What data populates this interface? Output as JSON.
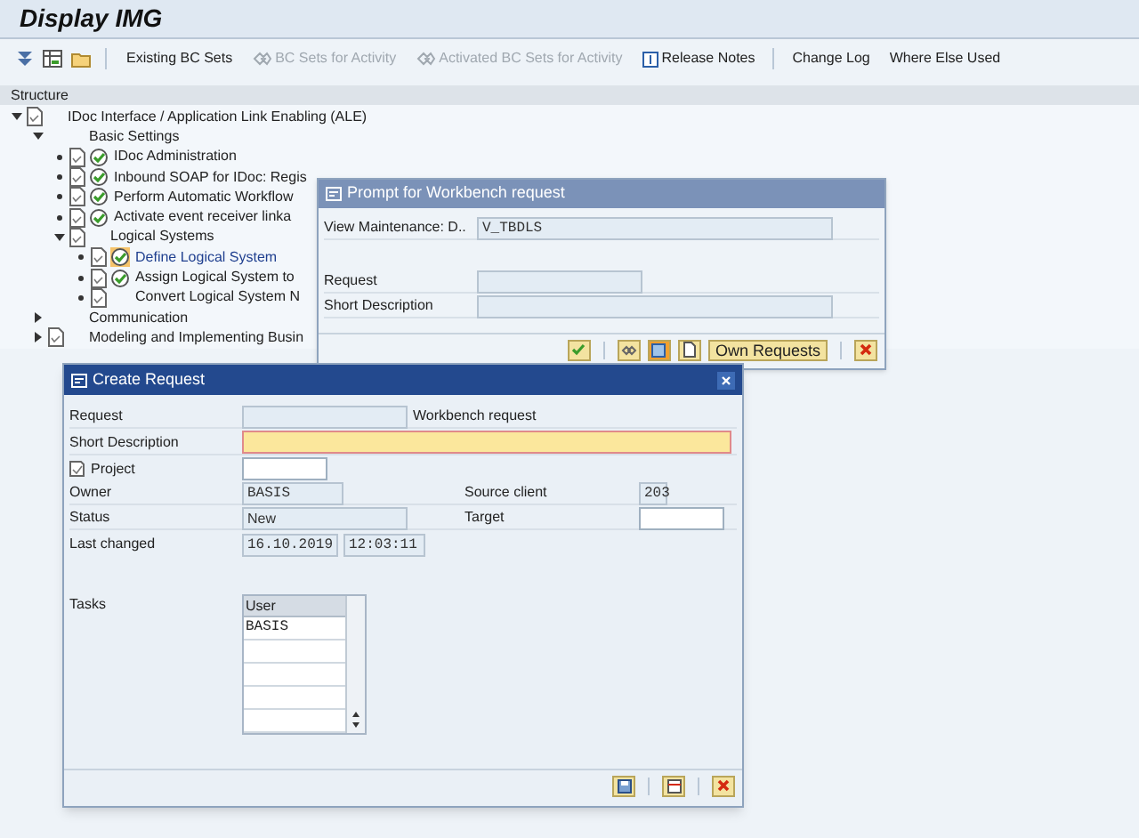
{
  "window": {
    "title": "Display IMG"
  },
  "toolbar": [
    {
      "label": "Existing BC Sets",
      "disabled": false
    },
    {
      "label": "BC Sets for Activity",
      "disabled": true
    },
    {
      "label": "Activated BC Sets for Activity",
      "disabled": true
    },
    {
      "label": "Release Notes",
      "disabled": false
    },
    {
      "label": "Change Log",
      "disabled": false
    },
    {
      "label": "Where Else Used",
      "disabled": false
    }
  ],
  "structure": {
    "header": "Structure",
    "tree": [
      {
        "label": "IDoc Interface / Application Link Enabling (ALE)",
        "documented": true,
        "expanded": true,
        "children": [
          {
            "label": "Basic Settings",
            "documented": false,
            "expanded": true,
            "children": [
              {
                "label": "IDoc Administration",
                "documented": true,
                "executable": true,
                "selected": false
              },
              {
                "label": "Inbound SOAP for IDoc: Regis",
                "documented": true,
                "executable": true,
                "selected": false
              },
              {
                "label": "Perform Automatic Workflow",
                "documented": true,
                "executable": true,
                "selected": false
              },
              {
                "label": "Activate event receiver linka",
                "documented": true,
                "executable": true,
                "selected": false
              },
              {
                "label": "Logical Systems",
                "documented": true,
                "expanded": true,
                "children": [
                  {
                    "label": "Define Logical System",
                    "documented": true,
                    "executable": true,
                    "selected": true
                  },
                  {
                    "label": "Assign Logical System to",
                    "documented": true,
                    "executable": true,
                    "selected": false
                  },
                  {
                    "label": "Convert Logical System N",
                    "documented": true,
                    "executable": false,
                    "selected": false
                  }
                ]
              }
            ]
          },
          {
            "label": "Communication",
            "documented": false,
            "expanded": false
          },
          {
            "label": "Modeling and Implementing Busin",
            "documented": true,
            "expanded": false
          }
        ]
      }
    ]
  },
  "prompt_dialog": {
    "title": "Prompt for Workbench request",
    "fields": [
      {
        "label": "View Maintenance: D..",
        "value": "V_TBDLS"
      },
      {
        "label": "Request"
      },
      {
        "label": "Short Description"
      }
    ],
    "own_requests_button": "Own Requests"
  },
  "create_dialog": {
    "title": "Create Request",
    "request": {
      "label": "Request",
      "type_text": "Workbench request"
    },
    "short_description": {
      "label": "Short Description",
      "required": true
    },
    "project": {
      "label": "Project"
    },
    "owner": {
      "label": "Owner",
      "value": "BASIS"
    },
    "source_client": {
      "label": "Source client",
      "value": "203"
    },
    "status": {
      "label": "Status",
      "value": "New"
    },
    "target": {
      "label": "Target"
    },
    "last_changed": {
      "label": "Last changed",
      "date": "16.10.2019",
      "time": "12:03:11"
    },
    "tasks": {
      "label": "Tasks",
      "column": "User",
      "rows": [
        "BASIS"
      ]
    }
  }
}
